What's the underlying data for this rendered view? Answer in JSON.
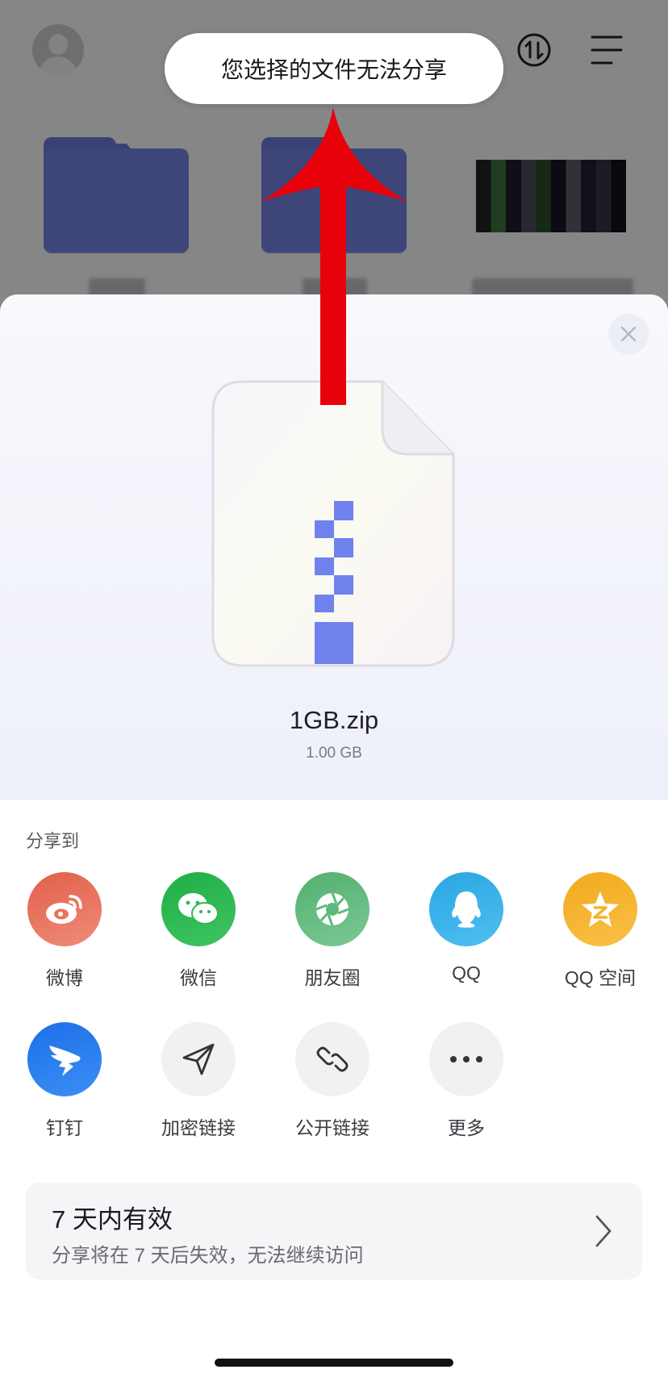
{
  "toast": {
    "message": "您选择的文件无法分享"
  },
  "file": {
    "name": "1GB.zip",
    "size": "1.00 GB"
  },
  "share": {
    "title": "分享到",
    "row1": [
      {
        "label": "微博",
        "icon": "weibo-icon",
        "color": "#e8735d"
      },
      {
        "label": "微信",
        "icon": "wechat-icon",
        "color": "#2fb94f"
      },
      {
        "label": "朋友圈",
        "icon": "moments-icon",
        "color": "#5cba7c"
      },
      {
        "label": "QQ",
        "icon": "qq-icon",
        "color": "#3aaee6"
      },
      {
        "label": "QQ 空间",
        "icon": "qzone-icon",
        "color": "#f5b32b"
      }
    ],
    "row2": [
      {
        "label": "钉钉",
        "icon": "dingtalk-icon",
        "color": "#2a7ef0"
      },
      {
        "label": "加密链接",
        "icon": "send-icon",
        "color": "#f1f1f3"
      },
      {
        "label": "公开链接",
        "icon": "link-icon",
        "color": "#f1f1f3"
      },
      {
        "label": "更多",
        "icon": "more-icon",
        "color": "#f1f1f3"
      }
    ]
  },
  "validity": {
    "title": "7 天内有效",
    "subtitle": "分享将在 7 天后失效，无法继续访问"
  },
  "annotation_color": "#e8000b"
}
